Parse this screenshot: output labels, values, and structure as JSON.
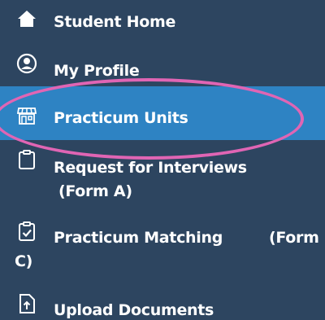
{
  "sidebar": {
    "items": [
      {
        "label": "Student Home",
        "icon": "home-icon"
      },
      {
        "label": "My Profile",
        "icon": "user-circle-icon"
      },
      {
        "label": "Practicum Units",
        "icon": "store-icon",
        "active": true
      },
      {
        "label": "Request for Interviews",
        "label_line2": "(Form A)",
        "icon": "clipboard-icon"
      },
      {
        "label": "Practicum Matching",
        "label_right": "(Form",
        "label_line2": "C)",
        "icon": "clipboard-check-icon"
      },
      {
        "label": "Upload Documents",
        "icon": "file-upload-icon"
      }
    ]
  },
  "colors": {
    "sidebar_bg": "#2d4560",
    "active_bg": "#2e83c3",
    "highlight_annotation": "#e065b4"
  }
}
